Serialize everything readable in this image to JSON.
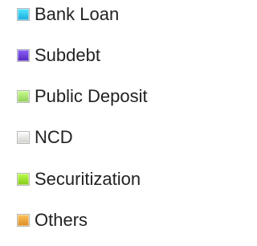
{
  "chart_data": {
    "type": "pie",
    "legend_placement": "right",
    "legend": [
      {
        "label": "Bank Loan",
        "color": "#32C3F5"
      },
      {
        "label": "Subdebt",
        "color": "#6A3FD6"
      },
      {
        "label": "Public Deposit",
        "color": "#A7E46F"
      },
      {
        "label": "NCD",
        "color": "#E9E7E2"
      },
      {
        "label": "Securitization",
        "color": "#9BE02F"
      },
      {
        "label": "Others",
        "color": "#F3A23A"
      }
    ]
  }
}
